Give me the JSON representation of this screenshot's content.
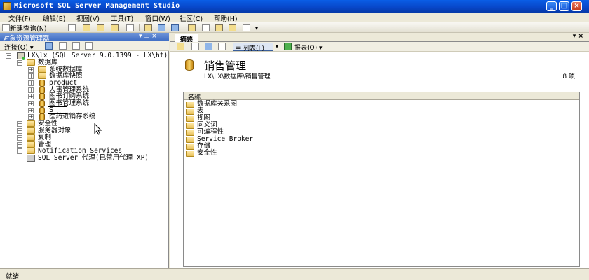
{
  "window": {
    "title": "Microsoft SQL Server Management Studio"
  },
  "menu": [
    "文件(F)",
    "编辑(E)",
    "视图(V)",
    "工具(T)",
    "窗口(W)",
    "社区(C)",
    "帮助(H)"
  ],
  "toolbar": {
    "new_query": "新建查询(N)"
  },
  "object_explorer": {
    "title": "对象资源管理器",
    "pin": "▾ ⊥ ×",
    "connect": "连接(O) ▾",
    "server": "LX\\lx (SQL Server 9.0.1399 - LX\\ht)",
    "databases": "数据库",
    "db_items": [
      "系统数据库",
      "数据库快照",
      "product",
      "人事管理系统",
      "图书订购系统",
      "图书管理系统",
      "S",
      "医药进销存系统"
    ],
    "top_items": [
      "安全性",
      "服务器对象",
      "复制",
      "管理",
      "Notification Services"
    ],
    "agent": "SQL Server 代理(已禁用代理 XP)"
  },
  "tab": {
    "label": "摘要",
    "controls": "▾ ×"
  },
  "summary_toolbar": {
    "list": "列表(L)",
    "report": "报表(O) ▾"
  },
  "summary": {
    "title": "销售管理",
    "path": "LX\\LX\\数据库\\销售管理",
    "count": "8 项",
    "column": "名称",
    "items": [
      "数据库关系图",
      "表",
      "视图",
      "同义词",
      "可编程性",
      "Service Broker",
      "存储",
      "安全性"
    ]
  },
  "status": {
    "text": "就绪"
  }
}
